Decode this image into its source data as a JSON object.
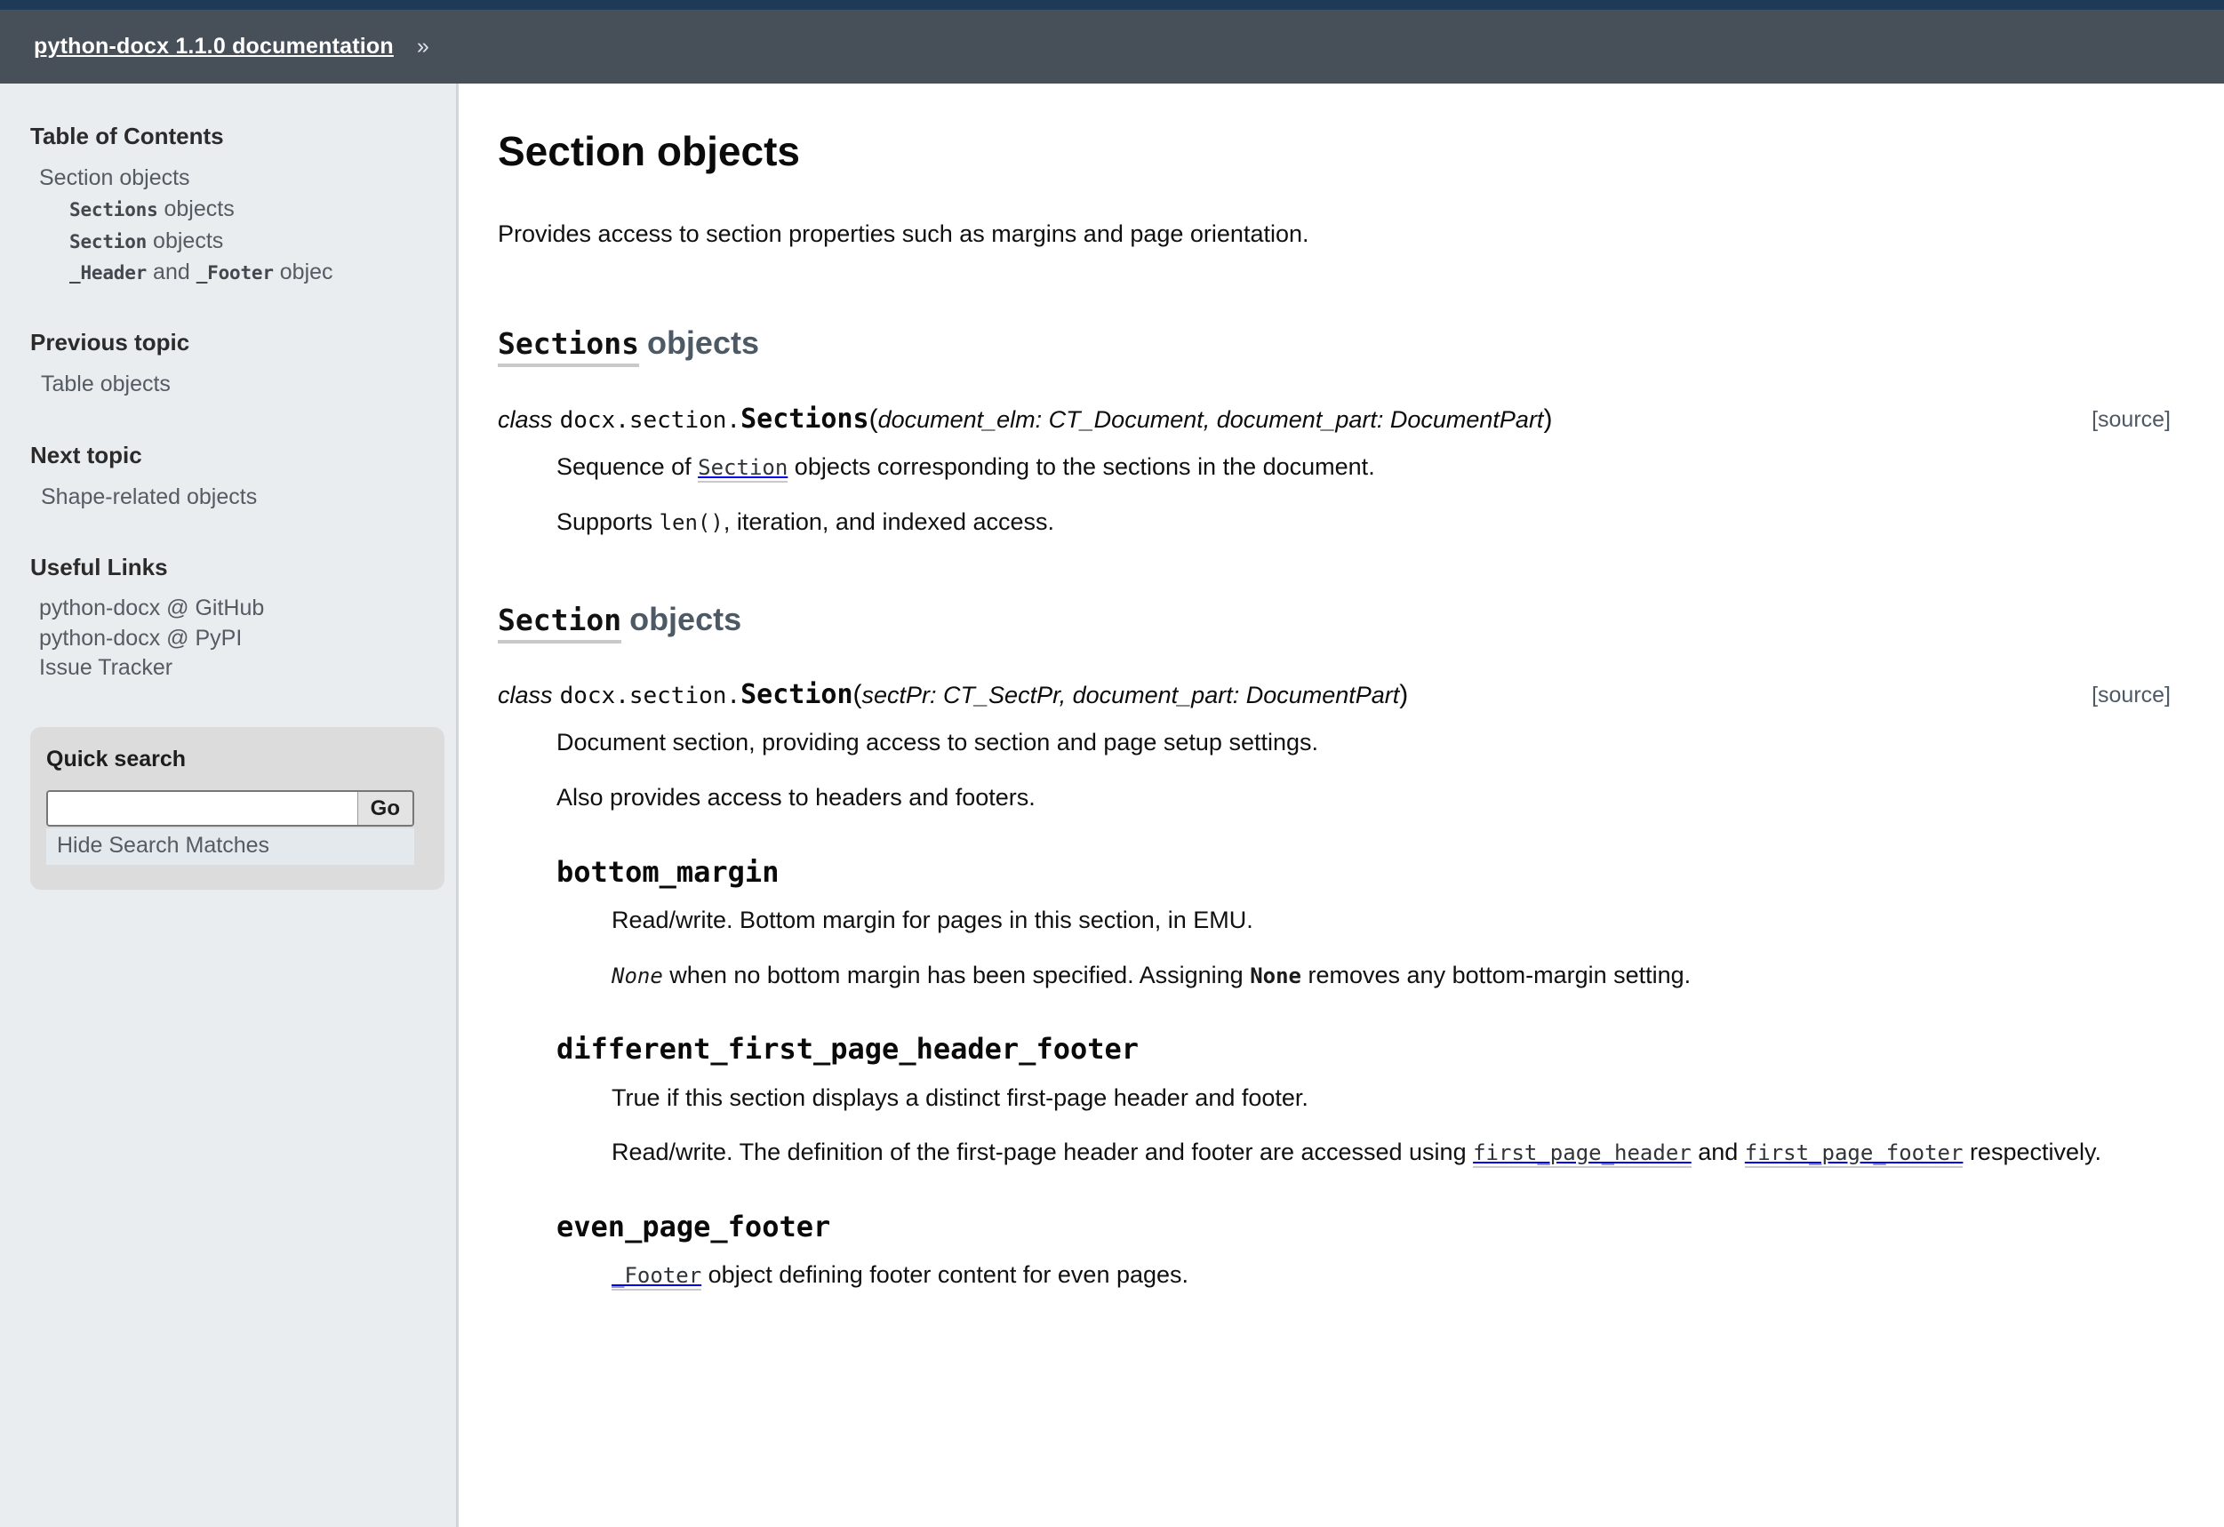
{
  "header": {
    "title": "python-docx 1.1.0 documentation",
    "separator": "»"
  },
  "sidebar": {
    "toc_heading": "Table of Contents",
    "toc": {
      "root": "Section objects",
      "items": [
        {
          "code": "Sections",
          "rest": " objects"
        },
        {
          "code": "Section",
          "rest": " objects"
        },
        {
          "code": "_Header",
          "mid": " and ",
          "code2": "_Footer",
          "rest": " objec"
        }
      ]
    },
    "previous_topic": {
      "heading": "Previous topic",
      "link": "Table objects"
    },
    "next_topic": {
      "heading": "Next topic",
      "link": "Shape-related objects"
    },
    "useful_links": {
      "heading": "Useful Links",
      "items": [
        "python-docx @ GitHub",
        "python-docx @ PyPI",
        "Issue Tracker"
      ]
    },
    "quick_search": {
      "heading": "Quick search",
      "input_value": "",
      "input_placeholder": "",
      "go_label": "Go",
      "hide_matches_label": "Hide Search Matches"
    }
  },
  "content": {
    "title": "Section objects",
    "lead": "Provides access to section properties such as margins and page orientation.",
    "sections": [
      {
        "heading_code": "Sections",
        "heading_rest": "objects",
        "signature": {
          "keyword": "class",
          "module": "docx.section.",
          "name": "Sections",
          "open_paren": "(",
          "params": "document_elm: CT_Document, document_part: DocumentPart",
          "close_paren": ")",
          "source_label": "[source]"
        },
        "paragraphs": [
          {
            "pre": "Sequence of ",
            "code_link": "Section",
            "post": " objects corresponding to the sections in the document."
          },
          {
            "pre": "Supports ",
            "code": "len()",
            "post": ", iteration, and indexed access."
          }
        ]
      },
      {
        "heading_code": "Section",
        "heading_rest": "objects",
        "signature": {
          "keyword": "class",
          "module": "docx.section.",
          "name": "Section",
          "open_paren": "(",
          "params": "sectPr: CT_SectPr, document_part: DocumentPart",
          "close_paren": ")",
          "source_label": "[source]"
        },
        "paragraphs": [
          {
            "text": "Document section, providing access to section and page setup settings."
          },
          {
            "text": "Also provides access to headers and footers."
          }
        ],
        "attributes": [
          {
            "name": "bottom_margin",
            "paragraphs": [
              {
                "text": "Read/write. Bottom margin for pages in this section, in EMU."
              },
              {
                "code_ital": "None",
                "mid": " when no bottom margin has been specified. Assigning ",
                "code_bold": "None",
                "post": " removes any bottom-margin setting."
              }
            ]
          },
          {
            "name": "different_first_page_header_footer",
            "paragraphs": [
              {
                "text": "True if this section displays a distinct first-page header and footer."
              },
              {
                "pre": "Read/write. The definition of the first-page header and footer are accessed using ",
                "code_link1": "first_page_header",
                "mid": " and ",
                "code_link2": "first_page_footer",
                "post": " respectively."
              }
            ]
          },
          {
            "name": "even_page_footer",
            "paragraphs": [
              {
                "code_link1": "_Footer",
                "post": " object defining footer content for even pages."
              }
            ]
          }
        ]
      }
    ]
  }
}
